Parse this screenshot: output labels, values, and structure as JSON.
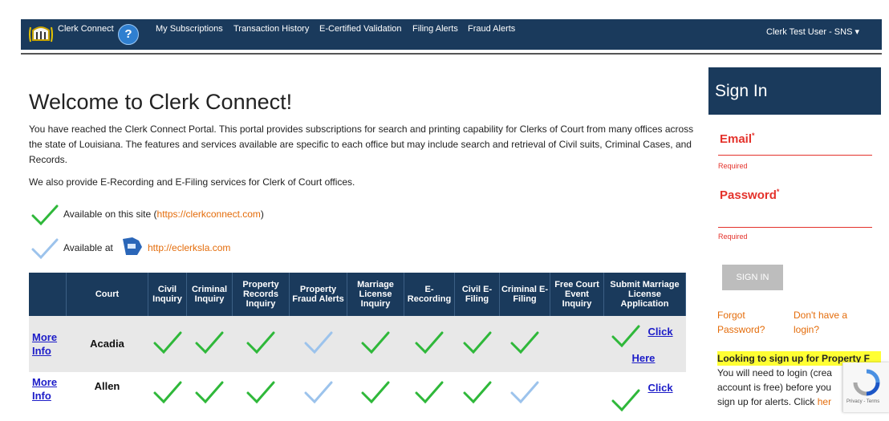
{
  "nav": {
    "brand": "Clerk Connect",
    "help": "?",
    "links": [
      "My Subscriptions",
      "Transaction History",
      "E-Certified Validation",
      "Filing Alerts",
      "Fraud Alerts"
    ],
    "user": "Clerk Test User - SNS ▾"
  },
  "main": {
    "title": "Welcome to Clerk Connect!",
    "intro": "You have reached the Clerk Connect Portal. This portal provides subscriptions for search and printing capability for Clerks of Court from many offices across the state of Louisiana. The features and services available are specific to each office but may include search and retrieval of Civil suits, Criminal Cases, and Records.",
    "services": "We also provide E-Recording and E-Filing services for Clerk of Court offices.",
    "legend_site_prefix": "Available on this site (",
    "legend_site_url": "https://clerkconnect.com",
    "legend_site_suffix": ")",
    "legend_ext_prefix": "Available at",
    "legend_ext_url": "http://eclerksla.com"
  },
  "table": {
    "headers": [
      "",
      "Court",
      "Civil Inquiry",
      "Criminal Inquiry",
      "Property Records Inquiry",
      "Property Fraud Alerts",
      "Marriage License Inquiry",
      "E-Recording",
      "Civil E-Filing",
      "Criminal E-Filing",
      "Free Court Event Inquiry",
      "Submit Marriage License Application"
    ],
    "more_info": "More Info",
    "click_here_1": "Click",
    "click_here_2": "Here",
    "rows": [
      {
        "court": "Acadia",
        "checks": [
          "green",
          "green",
          "green",
          "blue",
          "green",
          "green",
          "green",
          "green",
          "",
          "green"
        ]
      },
      {
        "court": "Allen",
        "checks": [
          "green",
          "green",
          "green",
          "blue",
          "green",
          "green",
          "green",
          "blue",
          "",
          "green"
        ]
      }
    ]
  },
  "signin": {
    "title": "Sign In",
    "email_label": "Email",
    "password_label": "Password",
    "required_mark": "*",
    "required_text": "Required",
    "button": "SIGN IN",
    "forgot_1": "Forgot",
    "forgot_2": "Password?",
    "signup_1": "Don't have a",
    "signup_2": "login?",
    "promo_title": "Looking to sign up for Property F",
    "promo_text_1": "You will need to login (crea",
    "promo_text_2": "account is free) before you",
    "promo_text_3": "sign up for alerts. Click",
    "promo_link": "her",
    "recaptcha_footer": "Privacy - Terms"
  },
  "colors": {
    "navy": "#1a3a5c",
    "green_check": "#2fb83a",
    "blue_check": "#9cc3ec",
    "link_orange": "#e46c0a",
    "required_red": "#e4322b"
  },
  "icons": [
    "clerk-connect-logo-icon",
    "help-icon",
    "green-check-icon",
    "blue-check-icon",
    "eclerks-logo-icon",
    "recaptcha-icon"
  ]
}
